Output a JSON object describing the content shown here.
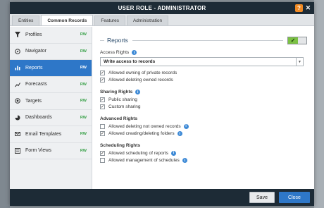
{
  "dialog": {
    "title": "USER ROLE - ADMINISTRATOR",
    "help_glyph": "?",
    "close_glyph": "✕"
  },
  "tabs": [
    {
      "label": "Entities"
    },
    {
      "label": "Common Records"
    },
    {
      "label": "Features"
    },
    {
      "label": "Administration"
    }
  ],
  "sidebar": {
    "items": [
      {
        "label": "Profiles",
        "badge": "RW",
        "icon": "filter-icon"
      },
      {
        "label": "Navigator",
        "badge": "RW",
        "icon": "navigator-icon"
      },
      {
        "label": "Reports",
        "badge": "RW",
        "icon": "reports-icon"
      },
      {
        "label": "Forecasts",
        "badge": "RW",
        "icon": "forecasts-icon"
      },
      {
        "label": "Targets",
        "badge": "RW",
        "icon": "target-icon"
      },
      {
        "label": "Dashboards",
        "badge": "RW",
        "icon": "dashboard-icon"
      },
      {
        "label": "Email Templates",
        "badge": "RW",
        "icon": "email-icon"
      },
      {
        "label": "Form Views",
        "badge": "RW",
        "icon": "form-icon"
      }
    ],
    "selected_index": 2
  },
  "main": {
    "section_title": "Reports",
    "toggle_glyph": "✓",
    "access_rights_label": "Access Rights",
    "access_rights_value": "Write access to records",
    "access_options": [
      {
        "label": "Allowed owning of private records",
        "checked": true
      },
      {
        "label": "Allowed deleting owned records",
        "checked": true
      }
    ],
    "sharing": {
      "title": "Sharing Rights",
      "options": [
        {
          "label": "Public sharing",
          "checked": true
        },
        {
          "label": "Custom sharing",
          "checked": true
        }
      ]
    },
    "advanced": {
      "title": "Advanced Rights",
      "options": [
        {
          "label": "Allowed deleting not owned records",
          "checked": false,
          "info": true
        },
        {
          "label": "Allowed creating/deleting folders",
          "checked": true,
          "info": true
        }
      ]
    },
    "scheduling": {
      "title": "Scheduling Rights",
      "options": [
        {
          "label": "Allowed scheduling of reports",
          "checked": true,
          "info": true
        },
        {
          "label": "Allowed management of schedules",
          "checked": false,
          "info": true
        }
      ]
    }
  },
  "footer": {
    "save_label": "Save",
    "close_label": "Close"
  },
  "colors": {
    "accent": "#2e77c8",
    "titlebar": "#1d2b36",
    "badge_green": "#3aa14a",
    "toggle_on": "#7bc143",
    "help_orange": "#f08a24"
  }
}
